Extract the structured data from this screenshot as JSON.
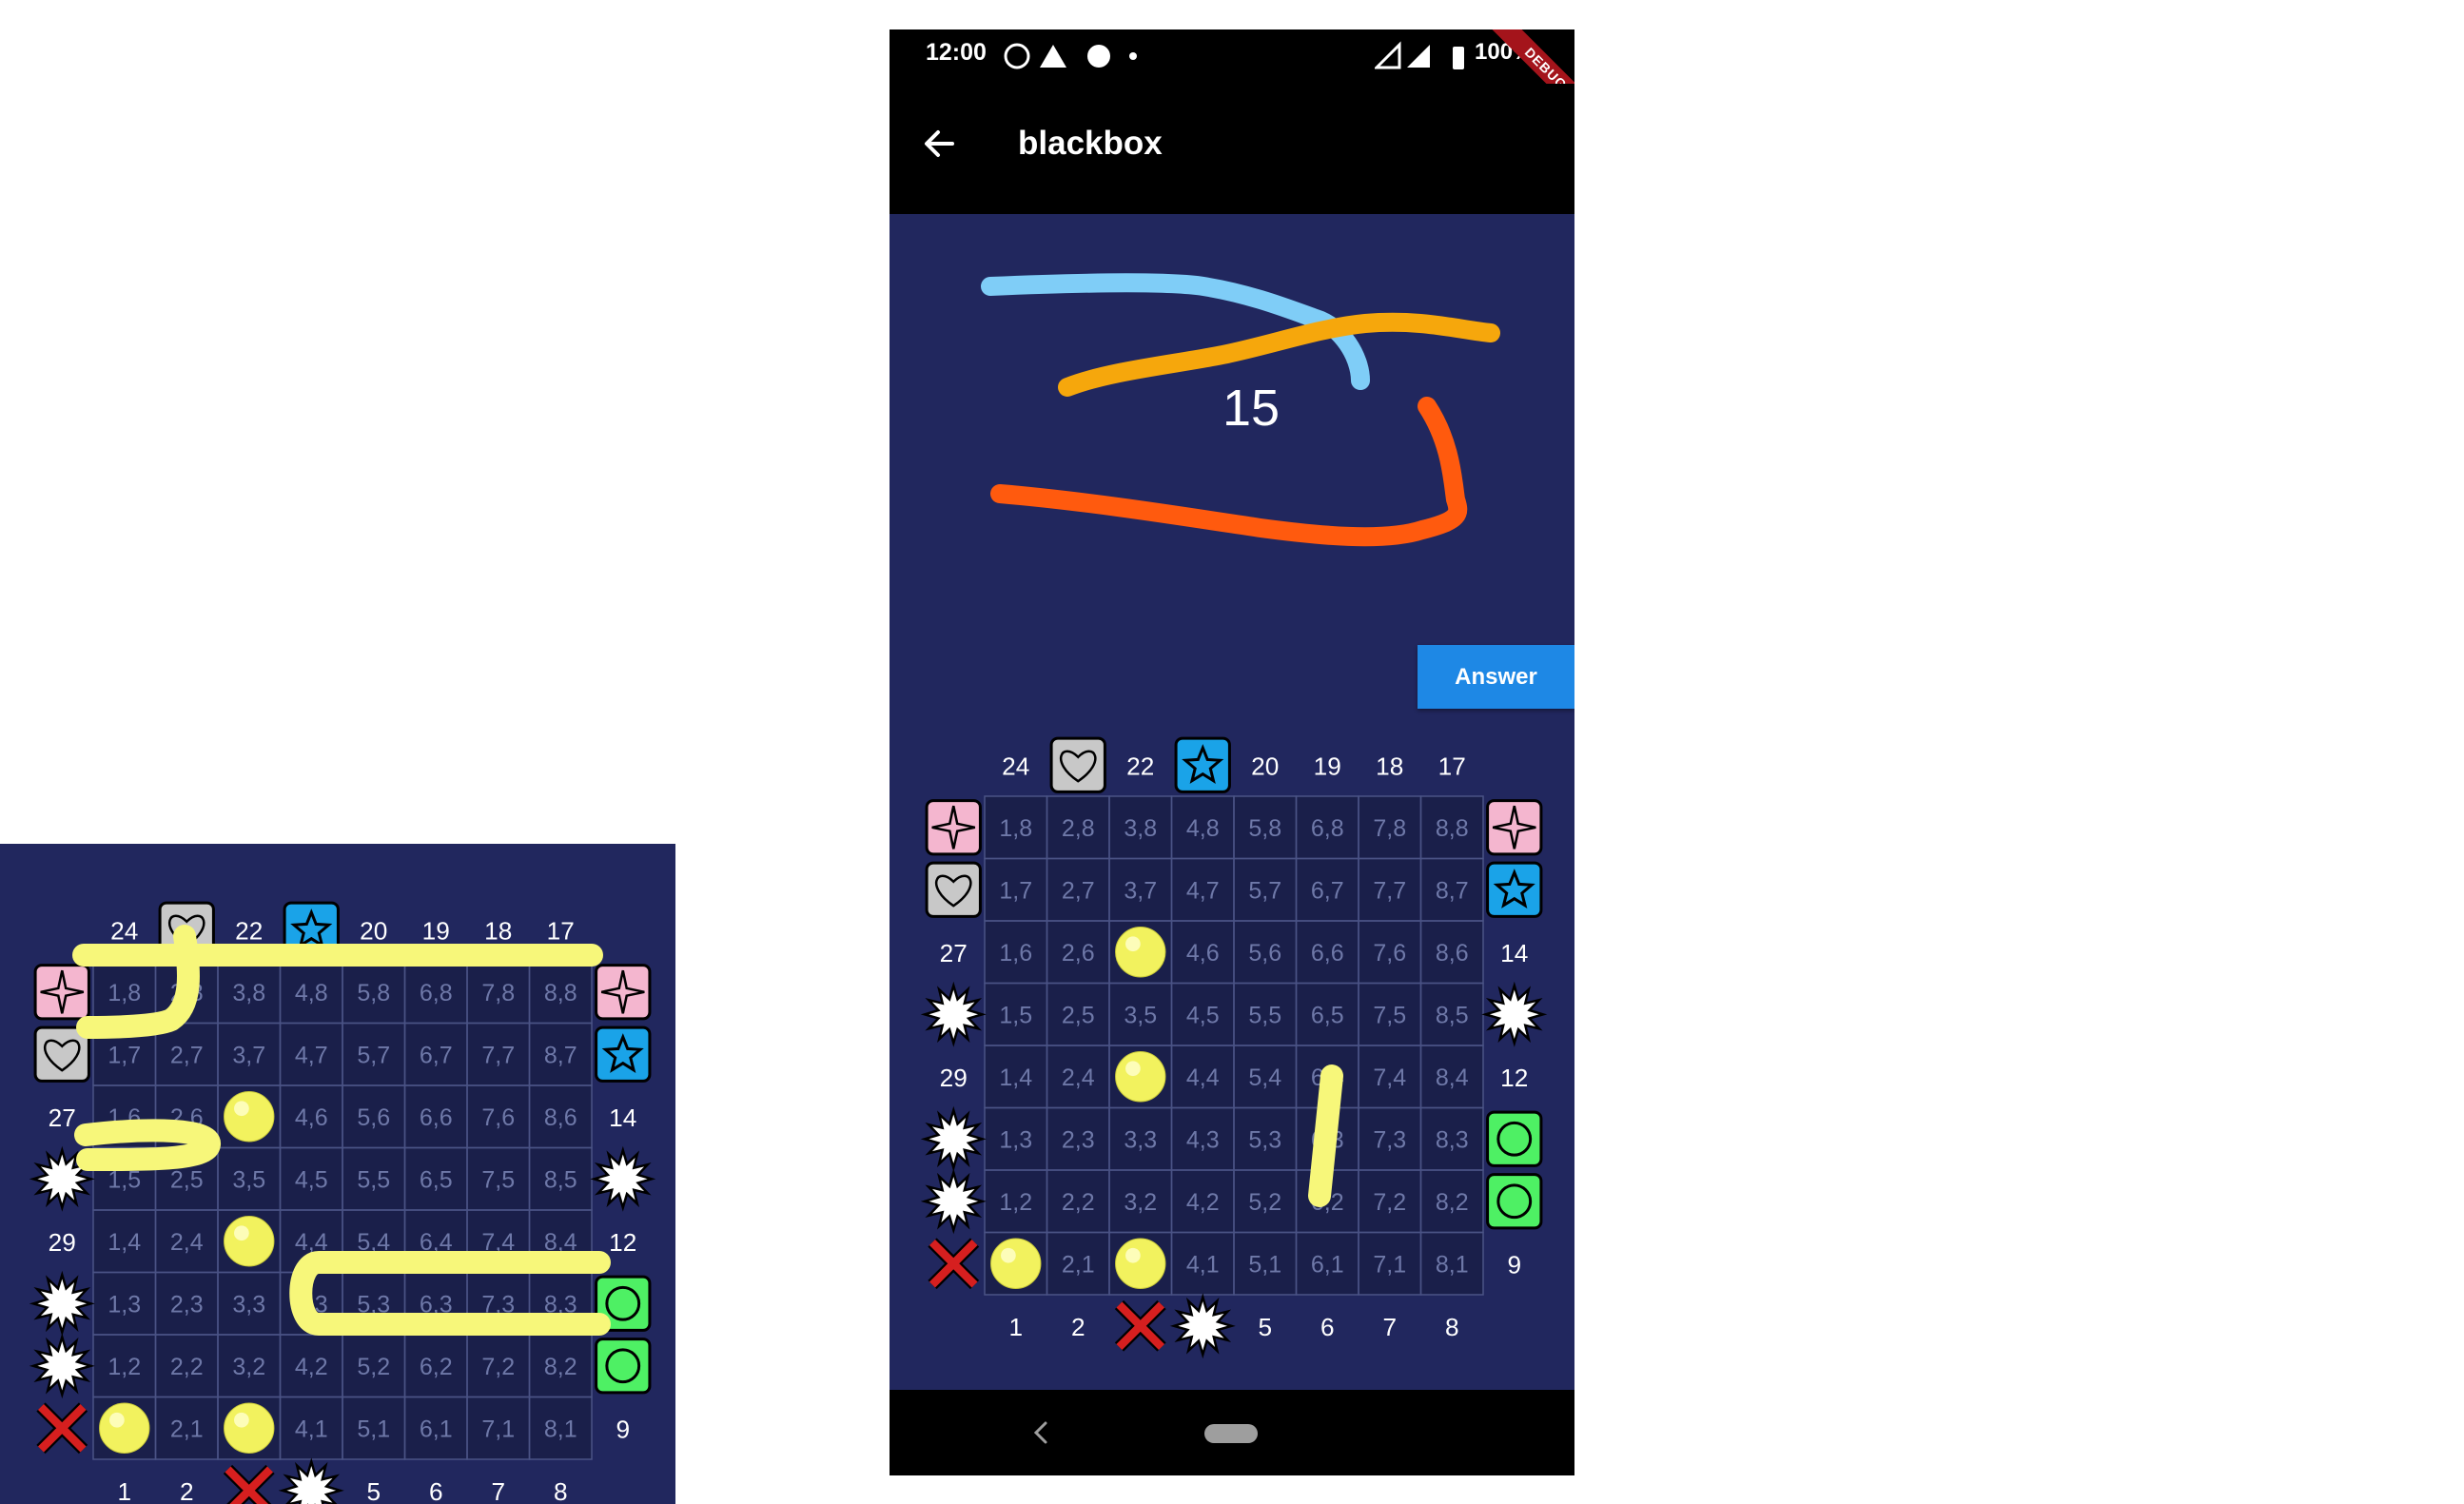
{
  "status_bar": {
    "time": "12:00",
    "battery": "100%",
    "debug_banner": "DEBUG"
  },
  "app_bar": {
    "title": "blackbox",
    "back_icon": "arrow-left-icon"
  },
  "answer_button": {
    "label": "Answer"
  },
  "scribble_number": "15",
  "colors": {
    "board_background": "#21275e",
    "cell_background": "#1a1f4a",
    "grid_line": "#4a5385",
    "ball": "#f2f25e",
    "pink_marker": "#f4b6cf",
    "gray_marker": "#c8c8c8",
    "blue_marker": "#1aa3e8",
    "green_marker": "#4ef064",
    "red_cross": "#d61f1f",
    "path_yellow": "#f7f77a",
    "scribble_lightblue": "#7fcdf7",
    "scribble_orange": "#f6a70c",
    "scribble_red": "#ff5a0e",
    "answer_button": "#1e88e5"
  },
  "boards": [
    {
      "id": "left",
      "cells": [
        [
          "1,8",
          "2,8",
          "3,8",
          "4,8",
          "5,8",
          "6,8",
          "7,8",
          "8,8"
        ],
        [
          "1,7",
          "2,7",
          "3,7",
          "4,7",
          "5,7",
          "6,7",
          "7,7",
          "8,7"
        ],
        [
          "1,6",
          "2,6",
          "3,6",
          "4,6",
          "5,6",
          "6,6",
          "7,6",
          "8,6"
        ],
        [
          "1,5",
          "2,5",
          "3,5",
          "4,5",
          "5,5",
          "6,5",
          "7,5",
          "8,5"
        ],
        [
          "1,4",
          "2,4",
          "3,4",
          "4,4",
          "5,4",
          "6,4",
          "7,4",
          "8,4"
        ],
        [
          "1,3",
          "2,3",
          "3,3",
          "4,3",
          "5,3",
          "6,3",
          "7,3",
          "8,3"
        ],
        [
          "1,2",
          "2,2",
          "3,2",
          "4,2",
          "5,2",
          "6,2",
          "7,2",
          "8,2"
        ],
        [
          "1,1",
          "2,1",
          "3,1",
          "4,1",
          "5,1",
          "6,1",
          "7,1",
          "8,1"
        ]
      ],
      "balls": [
        [
          2,
          2
        ],
        [
          4,
          2
        ],
        [
          7,
          0
        ],
        [
          7,
          2
        ]
      ],
      "top": [
        {
          "t": "num",
          "v": "24"
        },
        {
          "t": "gray-heart"
        },
        {
          "t": "num",
          "v": "22"
        },
        {
          "t": "blue-star"
        },
        {
          "t": "num",
          "v": "20"
        },
        {
          "t": "num",
          "v": "19"
        },
        {
          "t": "num",
          "v": "18"
        },
        {
          "t": "num",
          "v": "17"
        }
      ],
      "bottom": [
        {
          "t": "num",
          "v": "1"
        },
        {
          "t": "num",
          "v": "2"
        },
        {
          "t": "red-x"
        },
        {
          "t": "white-burst"
        },
        {
          "t": "num",
          "v": "5"
        },
        {
          "t": "num",
          "v": "6"
        },
        {
          "t": "num",
          "v": "7"
        },
        {
          "t": "num",
          "v": "8"
        }
      ],
      "left": [
        {
          "t": "pink-sparkle"
        },
        {
          "t": "gray-heart"
        },
        {
          "t": "num",
          "v": "27"
        },
        {
          "t": "white-burst"
        },
        {
          "t": "num",
          "v": "29"
        },
        {
          "t": "white-burst"
        },
        {
          "t": "white-burst"
        },
        {
          "t": "red-x"
        }
      ],
      "right": [
        {
          "t": "pink-sparkle"
        },
        {
          "t": "blue-star"
        },
        {
          "t": "num",
          "v": "14"
        },
        {
          "t": "white-burst"
        },
        {
          "t": "num",
          "v": "12"
        },
        {
          "t": "green-circle"
        },
        {
          "t": "green-circle"
        },
        {
          "t": "num",
          "v": "9"
        }
      ]
    },
    {
      "id": "right",
      "cells": [
        [
          "1,8",
          "2,8",
          "3,8",
          "4,8",
          "5,8",
          "6,8",
          "7,8",
          "8,8"
        ],
        [
          "1,7",
          "2,7",
          "3,7",
          "4,7",
          "5,7",
          "6,7",
          "7,7",
          "8,7"
        ],
        [
          "1,6",
          "2,6",
          "3,6",
          "4,6",
          "5,6",
          "6,6",
          "7,6",
          "8,6"
        ],
        [
          "1,5",
          "2,5",
          "3,5",
          "4,5",
          "5,5",
          "6,5",
          "7,5",
          "8,5"
        ],
        [
          "1,4",
          "2,4",
          "3,4",
          "4,4",
          "5,4",
          "6,4",
          "7,4",
          "8,4"
        ],
        [
          "1,3",
          "2,3",
          "3,3",
          "4,3",
          "5,3",
          "6,3",
          "7,3",
          "8,3"
        ],
        [
          "1,2",
          "2,2",
          "3,2",
          "4,2",
          "5,2",
          "6,2",
          "7,2",
          "8,2"
        ],
        [
          "1,1",
          "2,1",
          "3,1",
          "4,1",
          "5,1",
          "6,1",
          "7,1",
          "8,1"
        ]
      ],
      "balls": [
        [
          2,
          2
        ],
        [
          4,
          2
        ],
        [
          7,
          0
        ],
        [
          7,
          2
        ]
      ],
      "top": [
        {
          "t": "num",
          "v": "24"
        },
        {
          "t": "gray-heart"
        },
        {
          "t": "num",
          "v": "22"
        },
        {
          "t": "blue-star"
        },
        {
          "t": "num",
          "v": "20"
        },
        {
          "t": "num",
          "v": "19"
        },
        {
          "t": "num",
          "v": "18"
        },
        {
          "t": "num",
          "v": "17"
        }
      ],
      "bottom": [
        {
          "t": "num",
          "v": "1"
        },
        {
          "t": "num",
          "v": "2"
        },
        {
          "t": "red-x"
        },
        {
          "t": "white-burst"
        },
        {
          "t": "num",
          "v": "5"
        },
        {
          "t": "num",
          "v": "6"
        },
        {
          "t": "num",
          "v": "7"
        },
        {
          "t": "num",
          "v": "8"
        }
      ],
      "left": [
        {
          "t": "pink-sparkle"
        },
        {
          "t": "gray-heart"
        },
        {
          "t": "num",
          "v": "27"
        },
        {
          "t": "white-burst"
        },
        {
          "t": "num",
          "v": "29"
        },
        {
          "t": "white-burst"
        },
        {
          "t": "white-burst"
        },
        {
          "t": "red-x"
        }
      ],
      "right": [
        {
          "t": "pink-sparkle"
        },
        {
          "t": "blue-star"
        },
        {
          "t": "num",
          "v": "14"
        },
        {
          "t": "white-burst"
        },
        {
          "t": "num",
          "v": "12"
        },
        {
          "t": "green-circle"
        },
        {
          "t": "green-circle"
        },
        {
          "t": "num",
          "v": "9"
        }
      ]
    }
  ]
}
